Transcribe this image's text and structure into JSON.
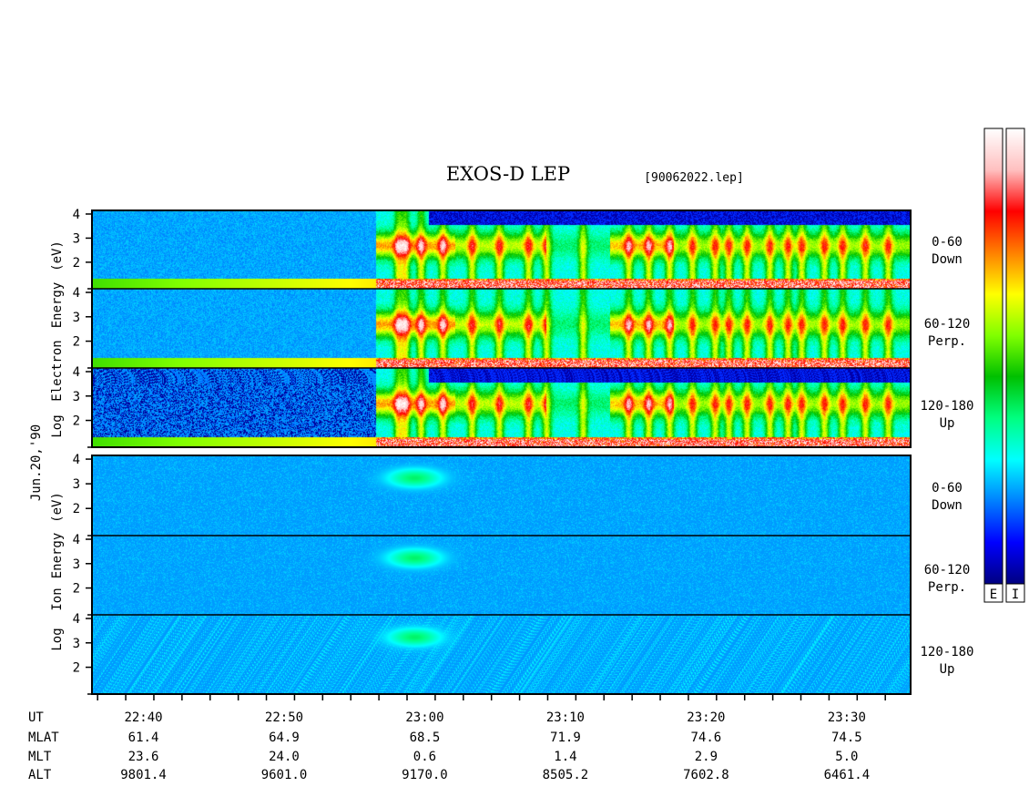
{
  "chart_data": {
    "type": "heatmap",
    "title": "EXOS-D LEP",
    "file": "[90062022.lep]",
    "date_label": "Jun.20,'90",
    "electron_ylabel": [
      "Log",
      "Electron",
      "Energy",
      "(eV)"
    ],
    "ion_ylabel": [
      "Log",
      "Ion",
      "Energy",
      "(eV)"
    ],
    "ylim": [
      0.9,
      4.15
    ],
    "y_ticks": [
      "4",
      "3",
      "2"
    ],
    "time_range_minutes": [
      22.61,
      23.58
    ],
    "x_ticks": [
      "22:40",
      "22:50",
      "23:00",
      "23:10",
      "23:20",
      "23:30"
    ],
    "panels": [
      {
        "group": "Electron",
        "pitch": "0-60",
        "direction": "Down"
      },
      {
        "group": "Electron",
        "pitch": "60-120",
        "direction": "Perp."
      },
      {
        "group": "Electron",
        "pitch": "120-180",
        "direction": "Up"
      },
      {
        "group": "Ion",
        "pitch": "0-60",
        "direction": "Down"
      },
      {
        "group": "Ion",
        "pitch": "60-120",
        "direction": "Perp."
      },
      {
        "group": "Ion",
        "pitch": "120-180",
        "direction": "Up"
      }
    ],
    "ephemeris": {
      "labels": [
        "UT",
        "MLAT",
        "MLT",
        "ALT"
      ],
      "rows": [
        [
          "22:40",
          "22:50",
          "23:00",
          "23:10",
          "23:20",
          "23:30"
        ],
        [
          "61.4",
          "64.9",
          "68.5",
          "71.9",
          "74.6",
          "74.5"
        ],
        [
          "23.6",
          "24.0",
          "0.6",
          "1.4",
          "2.9",
          "5.0"
        ],
        [
          "9801.4",
          "9601.0",
          "9170.0",
          "8505.2",
          "7602.8",
          "6461.4"
        ]
      ]
    },
    "colorbars": [
      "E",
      "I"
    ],
    "colormap": [
      "#000080",
      "#0000ff",
      "#0080ff",
      "#00ffff",
      "#00ff80",
      "#00c000",
      "#80ff00",
      "#ffff00",
      "#ff8000",
      "#ff0000",
      "#ffc0c0",
      "#ffffff"
    ]
  }
}
